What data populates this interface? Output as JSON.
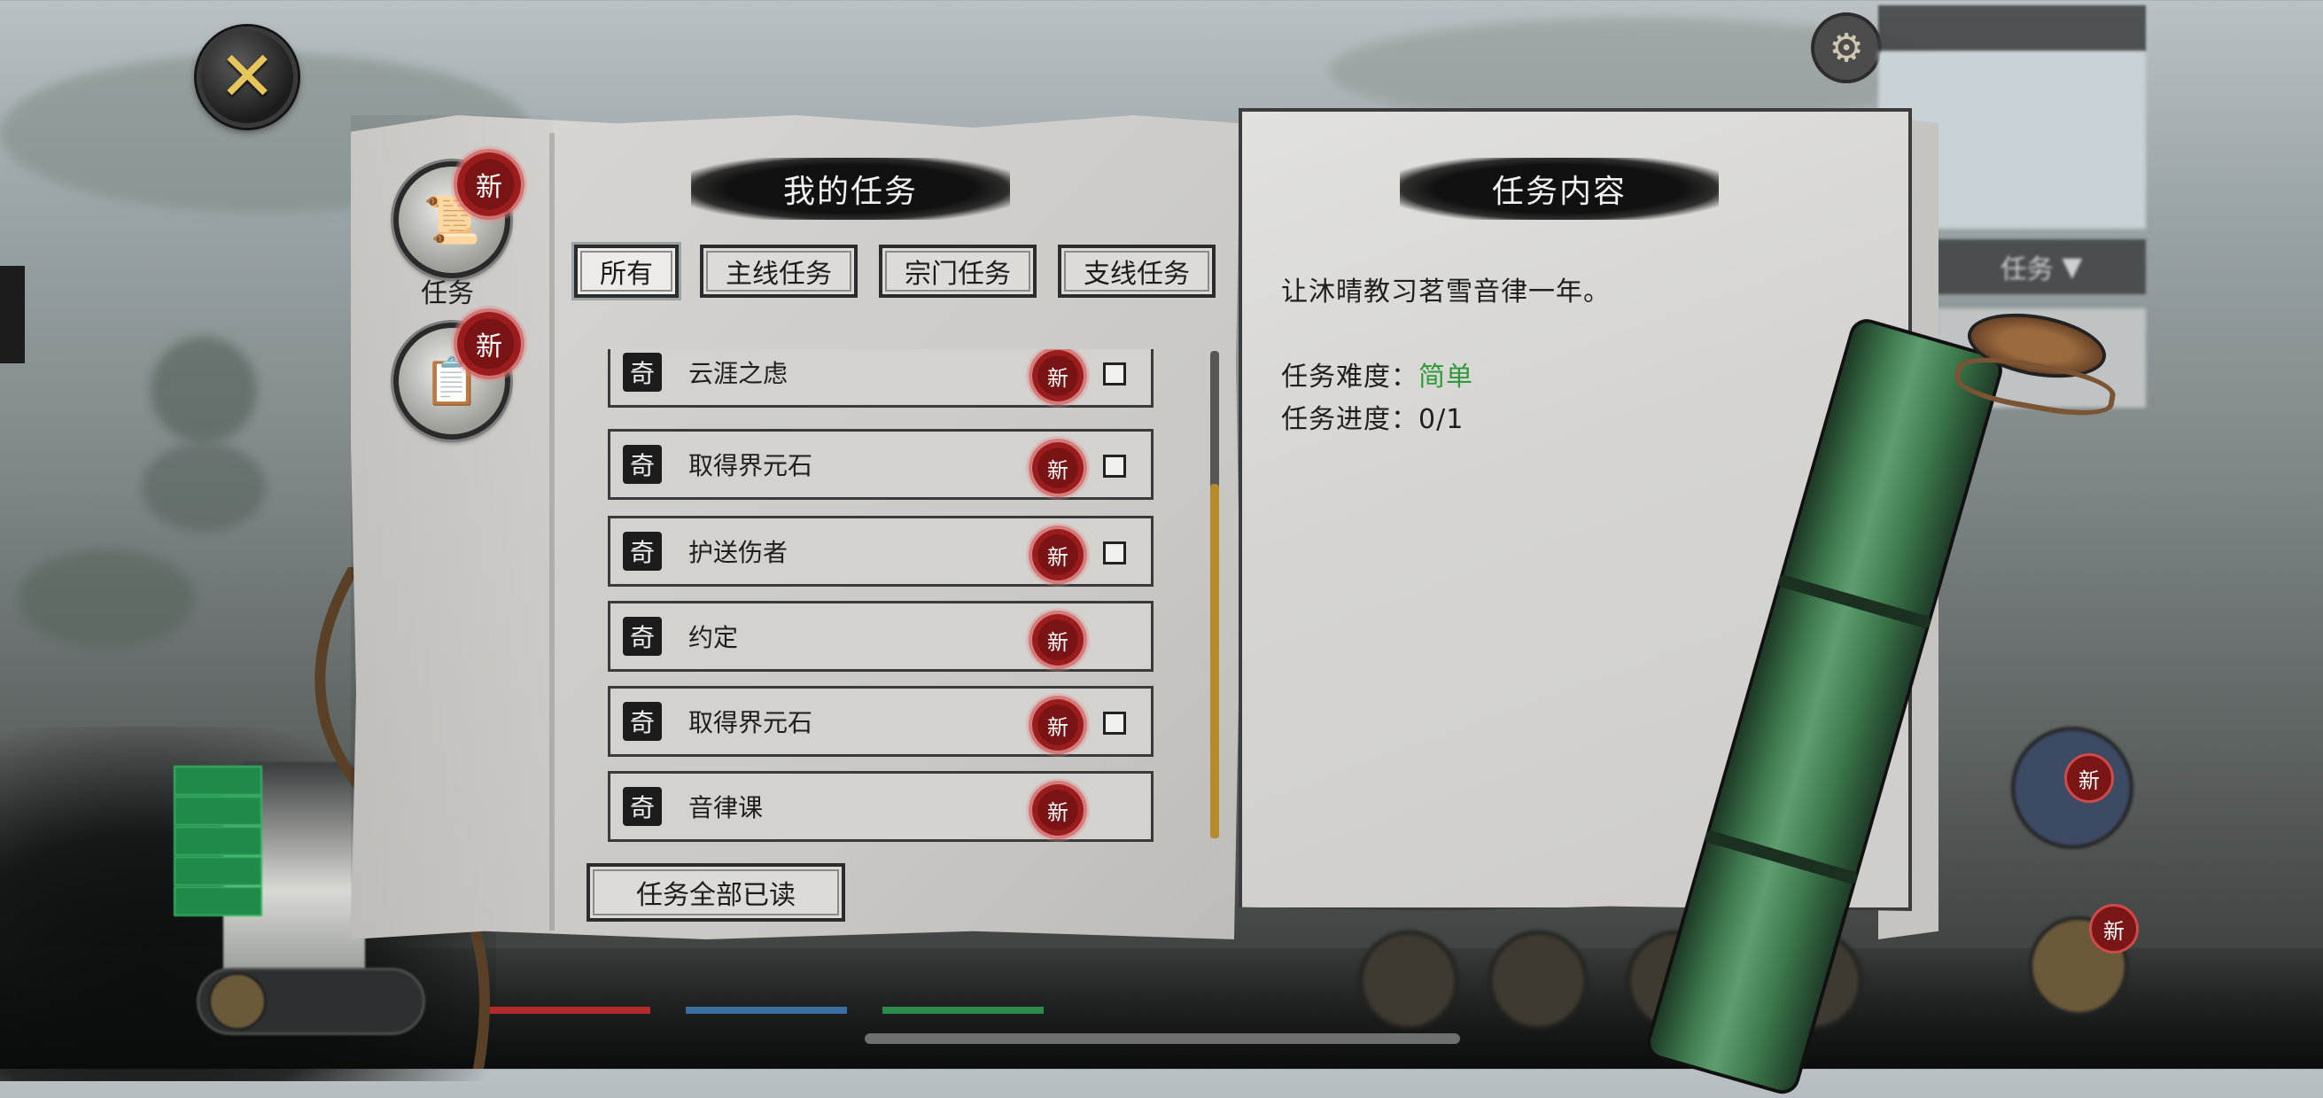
{
  "close_icon": "close-icon",
  "nav": {
    "quest_label": "任务",
    "new_badge": "新"
  },
  "my_tasks": {
    "header": "我的任务",
    "tabs": [
      "所有",
      "主线任务",
      "宗门任务",
      "支线任务"
    ],
    "active_tab": "所有",
    "items": [
      {
        "kind": "奇",
        "title": "云涯之虑",
        "badge": "新",
        "checkbox": true
      },
      {
        "kind": "奇",
        "title": "取得界元石",
        "badge": "新",
        "checkbox": true
      },
      {
        "kind": "奇",
        "title": "护送伤者",
        "badge": "新",
        "checkbox": true
      },
      {
        "kind": "奇",
        "title": "约定",
        "badge": "新",
        "checkbox": false
      },
      {
        "kind": "奇",
        "title": "取得界元石",
        "badge": "新",
        "checkbox": true
      },
      {
        "kind": "奇",
        "title": "音律课",
        "badge": "新",
        "checkbox": false
      }
    ],
    "read_all_button": "任务全部已读"
  },
  "task_detail": {
    "header": "任务内容",
    "description": "让沐晴教习茗雪音律一年。",
    "difficulty_label": "任务难度：",
    "difficulty_value": "简单",
    "progress_label": "任务进度：",
    "progress_value": "0/1"
  },
  "hud": {
    "right_tab": "任务"
  },
  "colors": {
    "difficulty_easy": "#2f9a3c",
    "new_badge": "#7a1414",
    "scroll_thumb": "#b48a2a"
  }
}
